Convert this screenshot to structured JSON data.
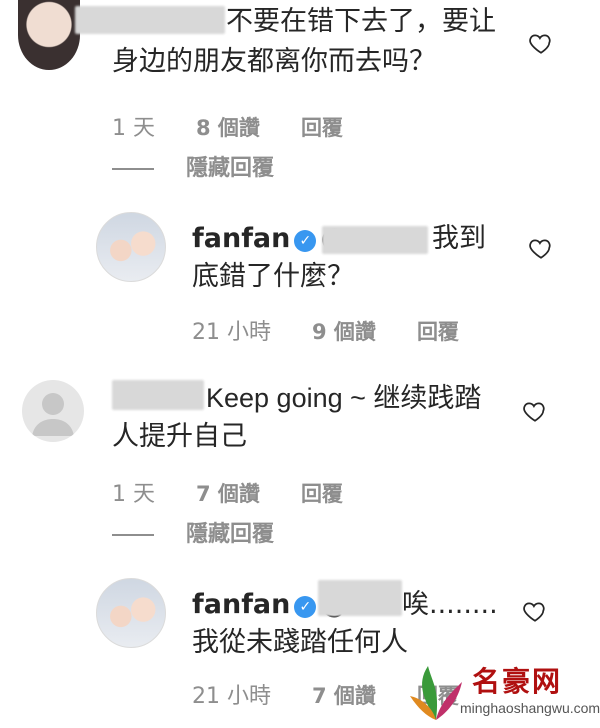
{
  "comments": [
    {
      "text_line1": "不要在错下去了，要让",
      "text_line2": "身边的朋友都离你而去吗？",
      "time": "1 天",
      "likes": "8 個讚",
      "reply": "回覆",
      "hidden_replies": "隱藏回覆"
    },
    {
      "username": "fanfan",
      "mention": "@",
      "text_line1_end": "我到",
      "text_line2": "底錯了什麼？",
      "time": "21 小時",
      "likes": "9 個讚",
      "reply": "回覆"
    },
    {
      "text_line1": "Keep going ~ 继续践踏",
      "text_line2": "人提升自己",
      "time": "1 天",
      "likes": "7 個讚",
      "reply": "回覆",
      "hidden_replies": "隱藏回覆"
    },
    {
      "username": "fanfan",
      "mention": "@",
      "text_line1_end": "唉........",
      "text_line2": "我從未踐踏任何人",
      "time": "21 小時",
      "likes": "7 個讚",
      "reply": "回覆"
    }
  ],
  "icons": {
    "like": "heart-outline-icon",
    "verified": "verified-badge-icon"
  },
  "colors": {
    "text": "#262626",
    "meta": "#8e8e8e",
    "verified": "#3897f0",
    "watermark": "#b01010"
  },
  "watermark": {
    "title": "名豪网",
    "url": "minghaoshangwu.com"
  }
}
